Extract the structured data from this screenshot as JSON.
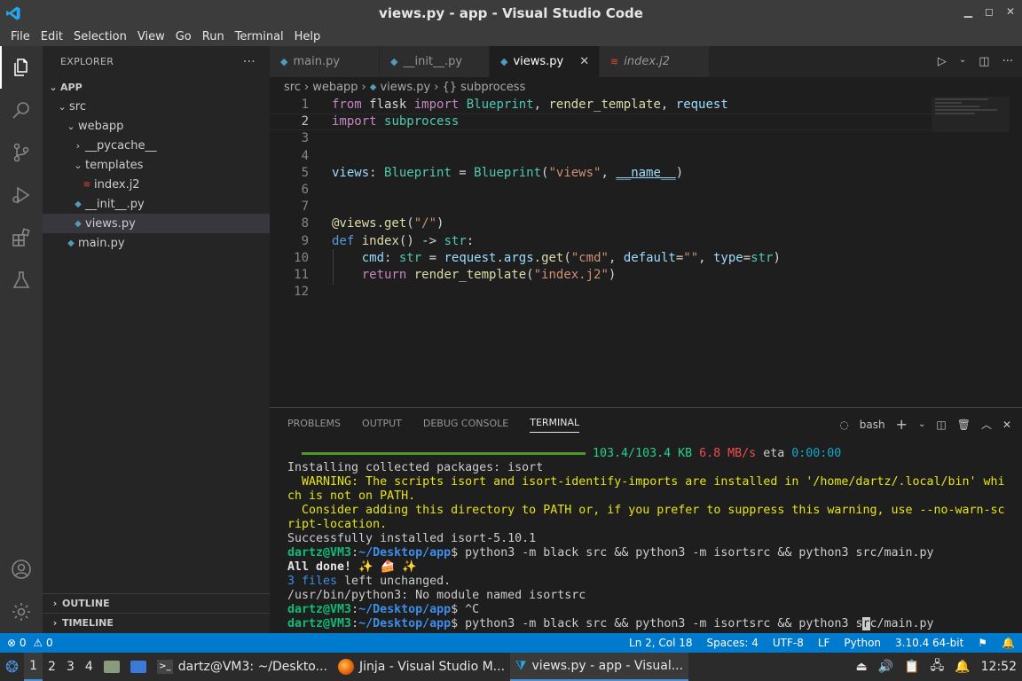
{
  "window": {
    "title": "views.py - app - Visual Studio Code"
  },
  "menu": [
    "File",
    "Edit",
    "Selection",
    "View",
    "Go",
    "Run",
    "Terminal",
    "Help"
  ],
  "explorer": {
    "header": "EXPLORER",
    "root": "APP",
    "items": [
      {
        "label": "src",
        "kind": "folder"
      },
      {
        "label": "webapp",
        "kind": "folder"
      },
      {
        "label": "__pycache__",
        "kind": "folder-collapsed"
      },
      {
        "label": "templates",
        "kind": "folder"
      },
      {
        "label": "index.j2",
        "kind": "jinja"
      },
      {
        "label": "__init__.py",
        "kind": "python"
      },
      {
        "label": "views.py",
        "kind": "python"
      },
      {
        "label": "main.py",
        "kind": "python"
      }
    ],
    "outline": "OUTLINE",
    "timeline": "TIMELINE"
  },
  "tabs": [
    {
      "label": "main.py",
      "icon": "python-icon"
    },
    {
      "label": "__init__.py",
      "icon": "python-icon"
    },
    {
      "label": "views.py",
      "icon": "python-icon",
      "active": true
    },
    {
      "label": "index.j2",
      "icon": "jinja-icon"
    }
  ],
  "breadcrumb": [
    "src",
    "webapp",
    "views.py",
    "{} subprocess"
  ],
  "editor": {
    "line_numbers": [
      "1",
      "2",
      "3",
      "4",
      "5",
      "6",
      "7",
      "8",
      "9",
      "10",
      "11",
      "12"
    ],
    "current_line": 2
  },
  "panel": {
    "tabs": [
      "PROBLEMS",
      "OUTPUT",
      "DEBUG CONSOLE",
      "TERMINAL"
    ],
    "shell": "bash",
    "terminal": {
      "progress": "103.4/103.4 KB",
      "speed": "6.8 MB/s",
      "eta_label": "eta",
      "eta": "0:00:00",
      "l1": "Installing collected packages: isort",
      "l2": "  WARNING: The scripts isort and isort-identify-imports are installed in '/home/dartz/.local/bin' whi",
      "l3": "ch is not on PATH.",
      "l4": "  Consider adding this directory to PATH or, if you prefer to suppress this warning, use --no-warn-sc",
      "l5": "ript-location.",
      "l6": "Successfully installed isort-5.10.1",
      "prompt_user": "dartz@VM3",
      "prompt_path": "~/Desktop/app",
      "cmd1": "$ python3 -m black src && python3 -m isortsrc && python3 src/main.py",
      "done": "All done! ✨ 🍰 ✨",
      "files_count": "3 files",
      "files_rest": " left unchanged.",
      "err": "/usr/bin/python3: No module named isortsrc",
      "cmd2": "$ ^C",
      "cmd3a": "$ python3 -m black src && python3 -m isortsrc && python3 s",
      "cmd3cur": "r",
      "cmd3b": "c/main.py"
    }
  },
  "status": {
    "errors": "0",
    "warnings": "0",
    "position": "Ln 2, Col 18",
    "spaces": "Spaces: 4",
    "encoding": "UTF-8",
    "eol": "LF",
    "language": "Python",
    "interpreter": "3.10.4 64-bit"
  },
  "taskbar": {
    "workspaces": [
      "1",
      "2",
      "3",
      "4"
    ],
    "apps": [
      {
        "label": "dartz@VM3: ~/Deskto..."
      },
      {
        "label": "Jinja - Visual Studio M..."
      },
      {
        "label": "views.py - app - Visual..."
      }
    ],
    "clock": "12:52"
  },
  "colors": {
    "accent": "#007acc",
    "activity": "#333333",
    "sidebar": "#252526",
    "editor": "#1e1e1e"
  }
}
